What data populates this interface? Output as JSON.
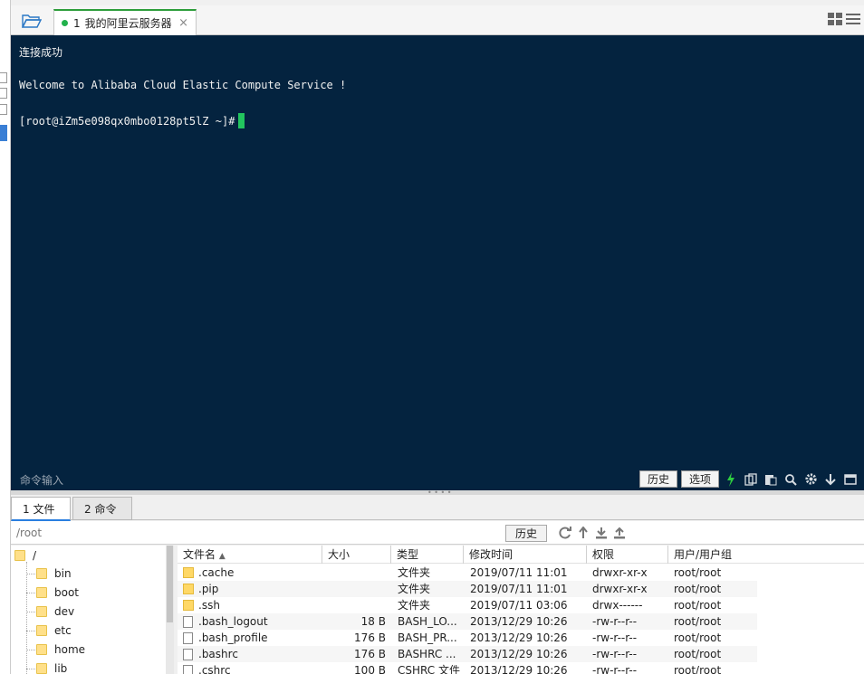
{
  "tab": {
    "number": "1",
    "title": "我的阿里云服务器",
    "close": "×"
  },
  "terminal": {
    "line1": "连接成功",
    "line2": "Welcome to Alibaba Cloud Elastic Compute Service !",
    "prompt": "[root@iZm5e098qx0mbo0128pt5lZ ~]#",
    "command_input_label": "命令输入",
    "history_btn": "历史",
    "options_btn": "选项"
  },
  "bottom_tabs": [
    {
      "label": "1 文件"
    },
    {
      "label": "2 命令"
    }
  ],
  "path": {
    "value": "/root",
    "history_btn": "历史"
  },
  "tree": {
    "root": "/",
    "items": [
      "bin",
      "boot",
      "dev",
      "etc",
      "home",
      "lib"
    ]
  },
  "columns": {
    "name": "文件名",
    "size": "大小",
    "type": "类型",
    "mtime": "修改时间",
    "perm": "权限",
    "owner": "用户/用户组"
  },
  "files": [
    {
      "name": ".cache",
      "size": "",
      "type": "文件夹",
      "mtime": "2019/07/11 11:01",
      "perm": "drwxr-xr-x",
      "owner": "root/root",
      "kind": "folder"
    },
    {
      "name": ".pip",
      "size": "",
      "type": "文件夹",
      "mtime": "2019/07/11 11:01",
      "perm": "drwxr-xr-x",
      "owner": "root/root",
      "kind": "folder"
    },
    {
      "name": ".ssh",
      "size": "",
      "type": "文件夹",
      "mtime": "2019/07/11 03:06",
      "perm": "drwx------",
      "owner": "root/root",
      "kind": "folder"
    },
    {
      "name": ".bash_logout",
      "size": "18 B",
      "type": "BASH_LO...",
      "mtime": "2013/12/29 10:26",
      "perm": "-rw-r--r--",
      "owner": "root/root",
      "kind": "file"
    },
    {
      "name": ".bash_profile",
      "size": "176 B",
      "type": "BASH_PR...",
      "mtime": "2013/12/29 10:26",
      "perm": "-rw-r--r--",
      "owner": "root/root",
      "kind": "file"
    },
    {
      "name": ".bashrc",
      "size": "176 B",
      "type": "BASHRC ...",
      "mtime": "2013/12/29 10:26",
      "perm": "-rw-r--r--",
      "owner": "root/root",
      "kind": "file"
    },
    {
      "name": ".cshrc",
      "size": "100 B",
      "type": "CSHRC 文件",
      "mtime": "2013/12/29 10:26",
      "perm": "-rw-r--r--",
      "owner": "root/root",
      "kind": "file"
    }
  ],
  "colors": {
    "terminal_bg": "#04233f",
    "cursor": "#22c55e",
    "status_dot": "#22b14c",
    "active_tab": "#2a7fe0"
  }
}
